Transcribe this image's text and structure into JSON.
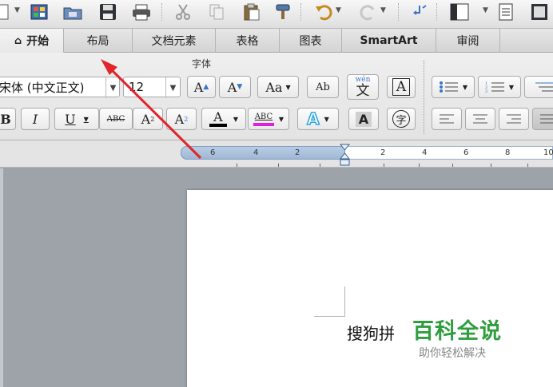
{
  "toolbar": {
    "icons": [
      "new-document-icon",
      "gallery-icon",
      "open-folder-icon",
      "save-icon",
      "print-icon",
      "cut-icon",
      "copy-icon",
      "paste-icon",
      "format-painter-icon",
      "undo-icon",
      "redo-icon",
      "sidebar-toggle-icon",
      "view-layout-icon",
      "document-icon"
    ]
  },
  "tabs": [
    {
      "label": "开始",
      "icon": "home-icon"
    },
    {
      "label": "布局"
    },
    {
      "label": "文档元素"
    },
    {
      "label": "表格"
    },
    {
      "label": "图表"
    },
    {
      "label": "SmartArt"
    },
    {
      "label": "审阅"
    }
  ],
  "ribbon": {
    "group_title": "字体",
    "font_name": "宋体 (中文正文)",
    "font_name_visible": "宋体 (中文正文)",
    "font_size": "12",
    "grow_font_label": "A",
    "shrink_font_label": "A",
    "change_case_label": "Aa",
    "clear_format_label": "Ab",
    "phonetic_label": "文",
    "phonetic_top": "wén",
    "char_border_label": "A",
    "bold_label": "B",
    "italic_label": "I",
    "underline_label": "U",
    "strike_label": "ABC",
    "superscript_label": "A",
    "subscript_label": "A",
    "font_color_label": "A",
    "highlight_label": "ABC",
    "text_effects_label": "A",
    "char_shading_label": "A",
    "enclose_char_label": "字",
    "colors": {
      "font_color": "#000000",
      "highlight": "#e020e0",
      "text_effects": "#2aa6e0"
    }
  },
  "ruler": {
    "labels": [
      "6",
      "4",
      "2",
      "2",
      "4",
      "6",
      "8",
      "10"
    ]
  },
  "document": {
    "text": "搜狗拼"
  },
  "watermark": {
    "title": "百科全说",
    "subtitle": "助你轻松解决"
  },
  "colors": {
    "accent": "#2e9e3e",
    "arrow": "#e0262a"
  }
}
